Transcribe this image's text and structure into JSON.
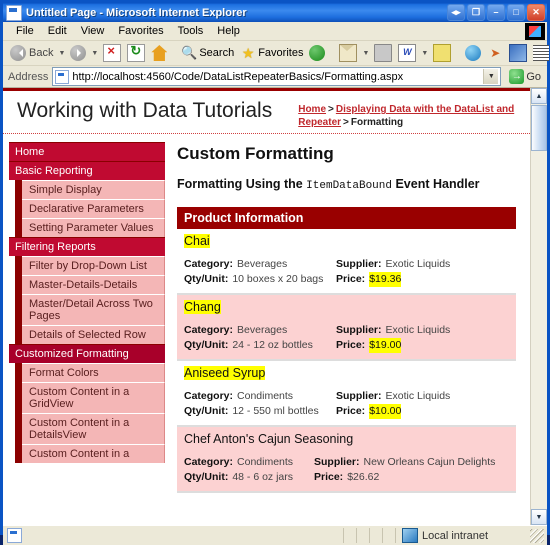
{
  "window": {
    "title": "Untitled Page - Microsoft Internet Explorer",
    "icon": "page-icon",
    "buttons": [
      {
        "name": "restore-group-button",
        "glyph": "◂▸"
      },
      {
        "name": "restore-window-button",
        "glyph": "❐"
      },
      {
        "name": "minimize-button",
        "glyph": "–"
      },
      {
        "name": "maximize-button",
        "glyph": "□"
      },
      {
        "name": "close-button",
        "glyph": "✕"
      }
    ]
  },
  "menu": {
    "items": [
      "File",
      "Edit",
      "View",
      "Favorites",
      "Tools",
      "Help"
    ]
  },
  "toolbar": {
    "back_label": "Back",
    "search_label": "Search",
    "favorites_label": "Favorites",
    "icons": {
      "back": "back-icon",
      "forward": "forward-icon",
      "stop": "stop-icon",
      "refresh": "refresh-icon",
      "home": "home-icon",
      "search": "search-icon",
      "favorites": "star-icon",
      "media": "media-icon",
      "mail": "mail-icon",
      "print": "print-icon",
      "edit": "edit-icon",
      "discuss": "notes-icon",
      "globe": "globe-icon",
      "messenger": "messenger-icon",
      "research": "research-icon",
      "encoding": "grid-icon"
    }
  },
  "address": {
    "label": "Address",
    "url": "http://localhost:4560/Code/DataListRepeaterBasics/Formatting.aspx",
    "go_label": "Go",
    "go_glyph": "→"
  },
  "site": {
    "title": "Working with Data Tutorials",
    "breadcrumb": {
      "home": "Home",
      "sep1": ">",
      "section": "Displaying Data with the DataList and Repeater",
      "sep2": ">",
      "current": "Formatting"
    }
  },
  "sidebar": {
    "items": [
      {
        "label": "Home",
        "type": "section",
        "active": false
      },
      {
        "label": "Basic Reporting",
        "type": "section",
        "active": false
      },
      {
        "label": "Simple Display",
        "type": "item",
        "active": false
      },
      {
        "label": "Declarative Parameters",
        "type": "item",
        "active": false
      },
      {
        "label": "Setting Parameter Values",
        "type": "item",
        "active": false
      },
      {
        "label": "Filtering Reports",
        "type": "section",
        "active": false
      },
      {
        "label": "Filter by Drop-Down List",
        "type": "item",
        "active": false
      },
      {
        "label": "Master-Details-Details",
        "type": "item",
        "active": false
      },
      {
        "label": "Master/Detail Across Two Pages",
        "type": "item",
        "active": false
      },
      {
        "label": "Details of Selected Row",
        "type": "item",
        "active": false
      },
      {
        "label": "Customized Formatting",
        "type": "section",
        "active": true
      },
      {
        "label": "Format Colors",
        "type": "item",
        "active": false
      },
      {
        "label": "Custom Content in a GridView",
        "type": "item",
        "active": false
      },
      {
        "label": "Custom Content in a DetailsView",
        "type": "item",
        "active": false
      },
      {
        "label": "Custom Content in a",
        "type": "item",
        "active": false
      }
    ]
  },
  "main": {
    "h1": "Custom Formatting",
    "h2_before": "Formatting Using the ",
    "h2_code": "ItemDataBound",
    "h2_after": " Event Handler",
    "datalist_header": "Product Information",
    "labels": {
      "category": "Category:",
      "supplier": "Supplier:",
      "qty": "Qty/Unit:",
      "price": "Price:"
    },
    "products": [
      {
        "name": "Chai",
        "name_highlight": true,
        "category": "Beverages",
        "supplier": "Exotic Liquids",
        "qty": "10 boxes x 20 bags",
        "price": "$19.36",
        "price_highlight": true,
        "alt": false
      },
      {
        "name": "Chang",
        "name_highlight": true,
        "category": "Beverages",
        "supplier": "Exotic Liquids",
        "qty": "24 - 12 oz bottles",
        "price": "$19.00",
        "price_highlight": true,
        "alt": true
      },
      {
        "name": "Aniseed Syrup",
        "name_highlight": true,
        "category": "Condiments",
        "supplier": "Exotic Liquids",
        "qty": "12 - 550 ml bottles",
        "price": "$10.00",
        "price_highlight": true,
        "alt": false
      },
      {
        "name": "Chef Anton's Cajun Seasoning",
        "name_highlight": false,
        "category": "Condiments",
        "supplier": "New Orleans Cajun Delights",
        "qty": "48 - 6 oz jars",
        "price": "$26.62",
        "price_highlight": false,
        "alt": true
      }
    ]
  },
  "statusbar": {
    "text": "",
    "zone": "Local intranet"
  },
  "colors": {
    "brand_dark_red": "#990000",
    "nav_section": "#c00a31",
    "nav_section_active": "#a8002a",
    "nav_item": "#f4b6b6",
    "alt_row": "#fcd2d2",
    "highlight": "#ffff00",
    "link": "#c0282d"
  }
}
